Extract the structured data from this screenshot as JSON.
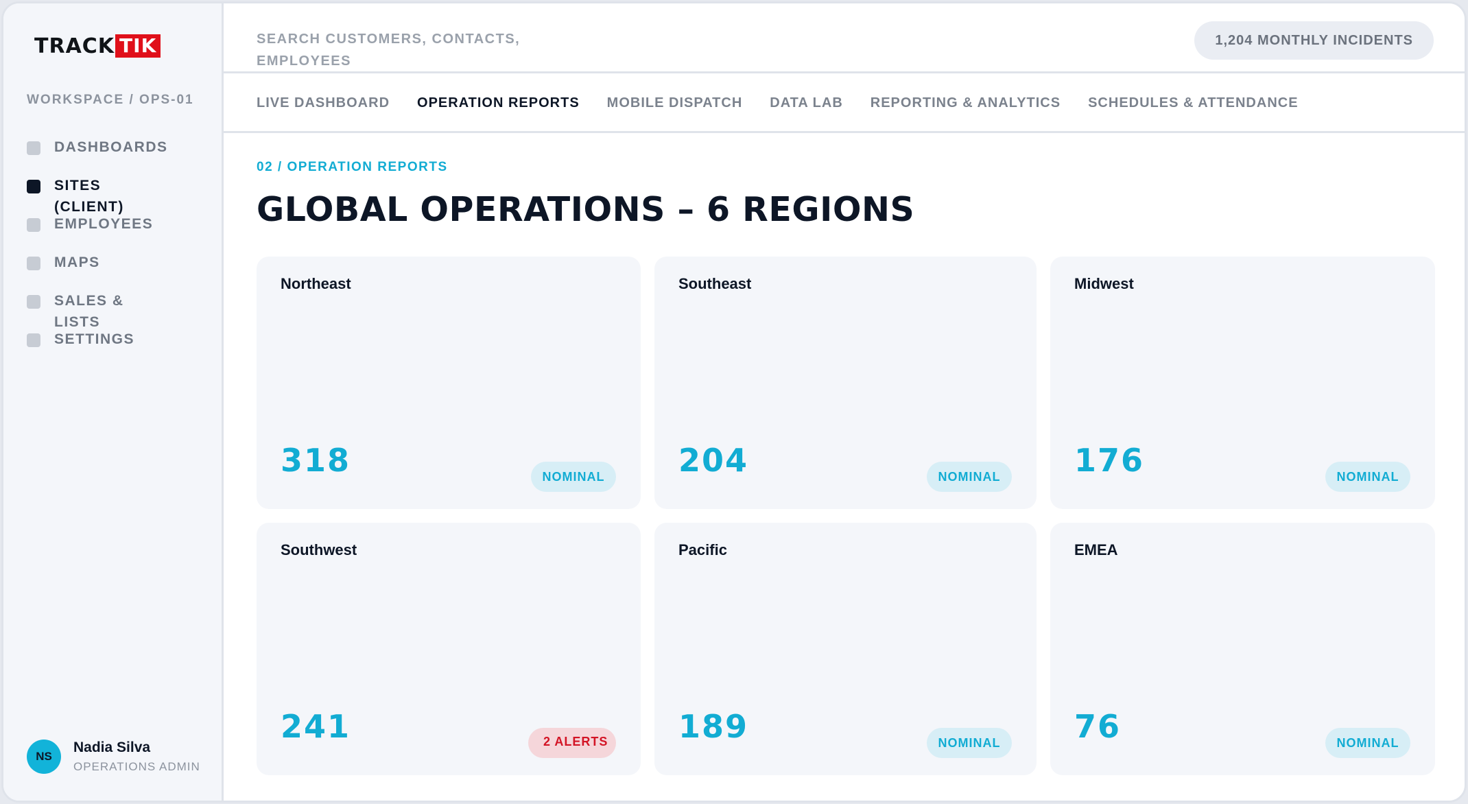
{
  "brand": {
    "track": "TRACK",
    "tik": "TIK",
    "accent": "#e0101a"
  },
  "sidebar": {
    "workspace": "WORKSPACE / OPS-01",
    "items": [
      {
        "label": "DASHBOARDS",
        "active": false
      },
      {
        "label": "SITES (CLIENT)",
        "active": true
      },
      {
        "label": "EMPLOYEES",
        "active": false
      },
      {
        "label": "MAPS",
        "active": false
      },
      {
        "label": "SALES & LISTS",
        "active": false
      },
      {
        "label": "SETTINGS",
        "active": false
      }
    ],
    "user": {
      "initials": "NS",
      "name": "Nadia Silva",
      "role": "OPERATIONS ADMIN"
    }
  },
  "header": {
    "search_placeholder": "SEARCH CUSTOMERS, CONTACTS, EMPLOYEES",
    "incidents": "1,204 MONTHLY INCIDENTS"
  },
  "tabs": [
    {
      "label": "LIVE DASHBOARD",
      "active": false
    },
    {
      "label": "OPERATION REPORTS",
      "active": true
    },
    {
      "label": "MOBILE DISPATCH",
      "active": false
    },
    {
      "label": "DATA LAB",
      "active": false
    },
    {
      "label": "REPORTING & ANALYTICS",
      "active": false
    },
    {
      "label": "SCHEDULES & ATTENDANCE",
      "active": false
    }
  ],
  "main": {
    "breadcrumb": "02 / OPERATION REPORTS",
    "title": "GLOBAL OPERATIONS – 6 REGIONS",
    "regions": [
      {
        "name": "Northeast",
        "value": "318",
        "status": "NOMINAL"
      },
      {
        "name": "Southeast",
        "value": "204",
        "status": "NOMINAL"
      },
      {
        "name": "Midwest",
        "value": "176",
        "status": "NOMINAL"
      },
      {
        "name": "Southwest",
        "value": "241",
        "status": "2 ALERTS"
      },
      {
        "name": "Pacific",
        "value": "189",
        "status": "NOMINAL"
      },
      {
        "name": "EMEA",
        "value": "76",
        "status": "NOMINAL"
      }
    ]
  },
  "colors": {
    "accent_cyan": "#12acd3",
    "alert_red": "#d31425",
    "text_dark": "#0d1626"
  }
}
